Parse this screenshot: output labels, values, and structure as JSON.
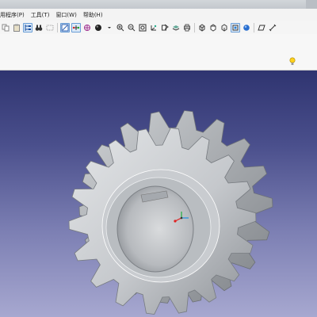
{
  "menu": {
    "items": [
      "用程序(P)",
      "工具(T)",
      "窗口(W)",
      "帮助(H)"
    ]
  },
  "toolbar": {
    "icons": [
      "copy-icon",
      "paste-icon",
      "select-tree-icon",
      "binoculars-icon",
      "dim-icon",
      "view-fit-icon",
      "arrange-icon",
      "grid-icon",
      "render-sphere-icon",
      "dropdown-icon",
      "zoom-in-icon",
      "zoom-out-icon",
      "zoom-area-icon",
      "axis-icon",
      "normal-view-icon",
      "layers-icon",
      "print-icon",
      "iso-view-icon",
      "front-view-icon",
      "top-view-icon",
      "box-view-icon",
      "shaded-icon",
      "sketch-icon",
      "measure-icon"
    ]
  },
  "colors": {
    "viewport_top": "#2f3470",
    "viewport_bottom": "#a7a8d0",
    "part_metal": "#c6c9cc",
    "axis_x": "#e02020",
    "axis_y": "#20b040",
    "axis_z": "#2090e0"
  },
  "viewport": {
    "model": "sprocket-gear",
    "status_icon": "lightbulb-icon"
  }
}
